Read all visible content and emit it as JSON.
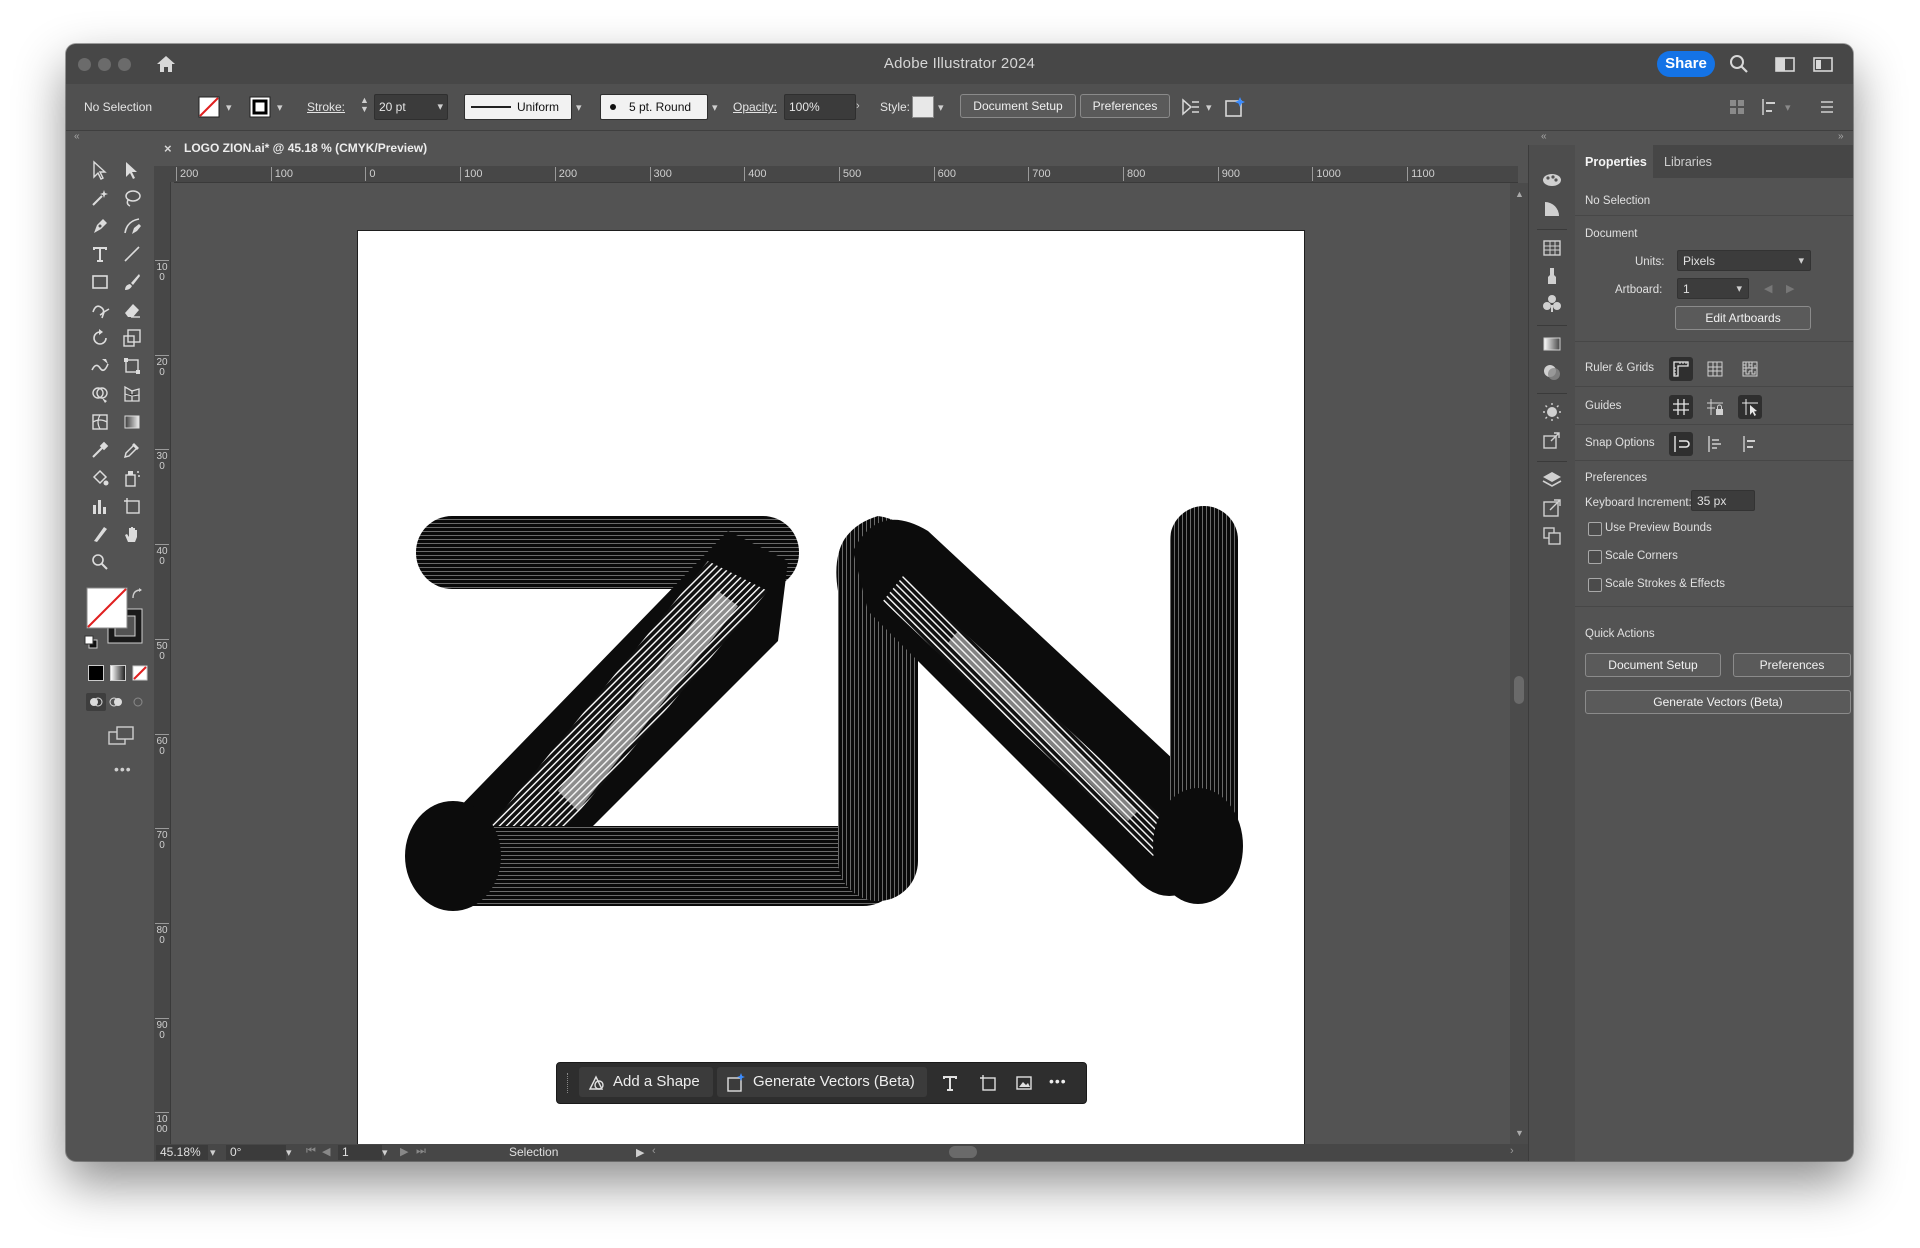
{
  "window": {
    "title": "Adobe Illustrator 2024",
    "share_label": "Share"
  },
  "controlbar": {
    "selection": "No Selection",
    "stroke_label": "Stroke:",
    "stroke_value": "20 pt",
    "profile": "Uniform",
    "brush": "5 pt. Round",
    "opacity_label": "Opacity:",
    "opacity_value": "100%",
    "style_label": "Style:",
    "document_setup": "Document Setup",
    "preferences": "Preferences"
  },
  "document": {
    "tab_title": "LOGO ZION.ai* @ 45.18 % (CMYK/Preview)",
    "close_glyph": "×"
  },
  "ruler": {
    "h_labels": [
      "200",
      "100",
      "0",
      "100",
      "200",
      "300",
      "400",
      "500",
      "600",
      "700",
      "800",
      "900",
      "1000",
      "1100"
    ],
    "v_labels": [
      "100",
      "200",
      "300",
      "400",
      "500",
      "600",
      "700",
      "800",
      "900",
      "1000"
    ]
  },
  "taskbar": {
    "add_shape": "Add a Shape",
    "generate_vectors": "Generate Vectors (Beta)",
    "more": "•••"
  },
  "status": {
    "zoom": "45.18%",
    "rotation": "0°",
    "artboard": "1",
    "tool": "Selection"
  },
  "panel": {
    "tabs": [
      "Properties",
      "Libraries"
    ],
    "selection": "No Selection",
    "document_heading": "Document",
    "units_label": "Units:",
    "units_value": "Pixels",
    "artboard_label": "Artboard:",
    "artboard_value": "1",
    "edit_artboards": "Edit Artboards",
    "ruler_grids": "Ruler & Grids",
    "guides": "Guides",
    "snap_options": "Snap Options",
    "preferences_heading": "Preferences",
    "keyboard_increment_label": "Keyboard Increment:",
    "keyboard_increment_value": "35 px",
    "checkboxes": [
      "Use Preview Bounds",
      "Scale Corners",
      "Scale Strokes & Effects"
    ],
    "quick_actions_heading": "Quick Actions",
    "qa_document_setup": "Document Setup",
    "qa_preferences": "Preferences",
    "qa_generate_vectors": "Generate Vectors (Beta)"
  },
  "collapse_glyphs": {
    "left": "«",
    "right": "»"
  },
  "colors": {
    "accent_blue": "#1473e6",
    "panel_bg": "#535353",
    "titlebar_bg": "#474747"
  }
}
